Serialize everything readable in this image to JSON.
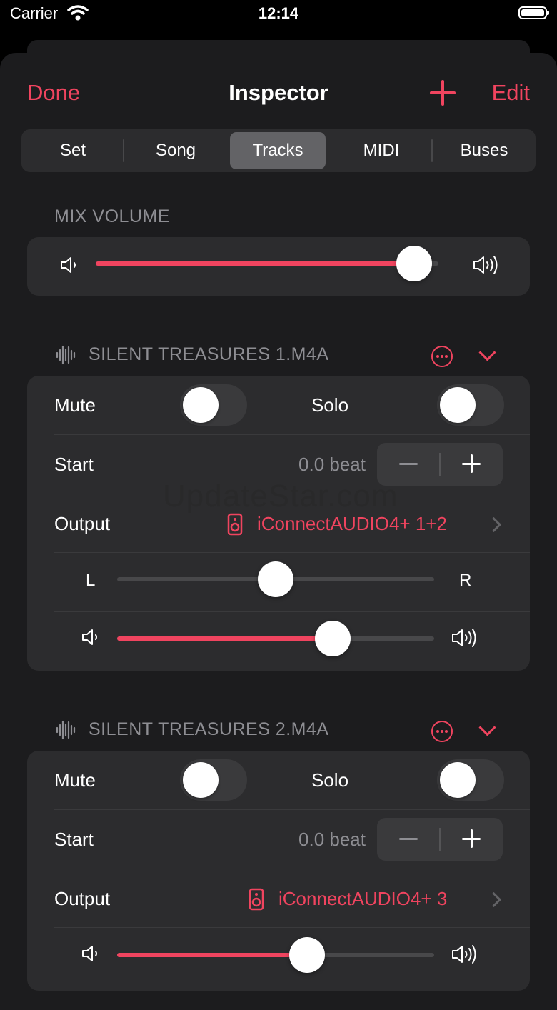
{
  "status": {
    "carrier": "Carrier",
    "time": "12:14"
  },
  "nav": {
    "done": "Done",
    "title": "Inspector",
    "edit": "Edit"
  },
  "tabs": [
    {
      "label": "Set",
      "selected": false
    },
    {
      "label": "Song",
      "selected": false
    },
    {
      "label": "Tracks",
      "selected": true
    },
    {
      "label": "MIDI",
      "selected": false
    },
    {
      "label": "Buses",
      "selected": false
    }
  ],
  "mix": {
    "label": "MIX VOLUME",
    "volume": 0.93
  },
  "tracks": [
    {
      "name": "SILENT TREASURES 1.M4A",
      "mute_label": "Mute",
      "mute": false,
      "solo_label": "Solo",
      "solo": false,
      "start_label": "Start",
      "start_value": "0.0 beat",
      "output_label": "Output",
      "output_value": "iConnectAUDIO4+ 1+2",
      "pan_left": "L",
      "pan_right": "R",
      "pan": 0.5,
      "volume": 0.68
    },
    {
      "name": "SILENT TREASURES 2.M4A",
      "mute_label": "Mute",
      "mute": false,
      "solo_label": "Solo",
      "solo": false,
      "start_label": "Start",
      "start_value": "0.0 beat",
      "output_label": "Output",
      "output_value": "iConnectAUDIO4+ 3",
      "volume": 0.6
    }
  ],
  "watermark": "UpdateStar.com",
  "colors": {
    "accent": "#f0445f",
    "background": "#1c1c1e",
    "card": "#2c2c2e"
  }
}
